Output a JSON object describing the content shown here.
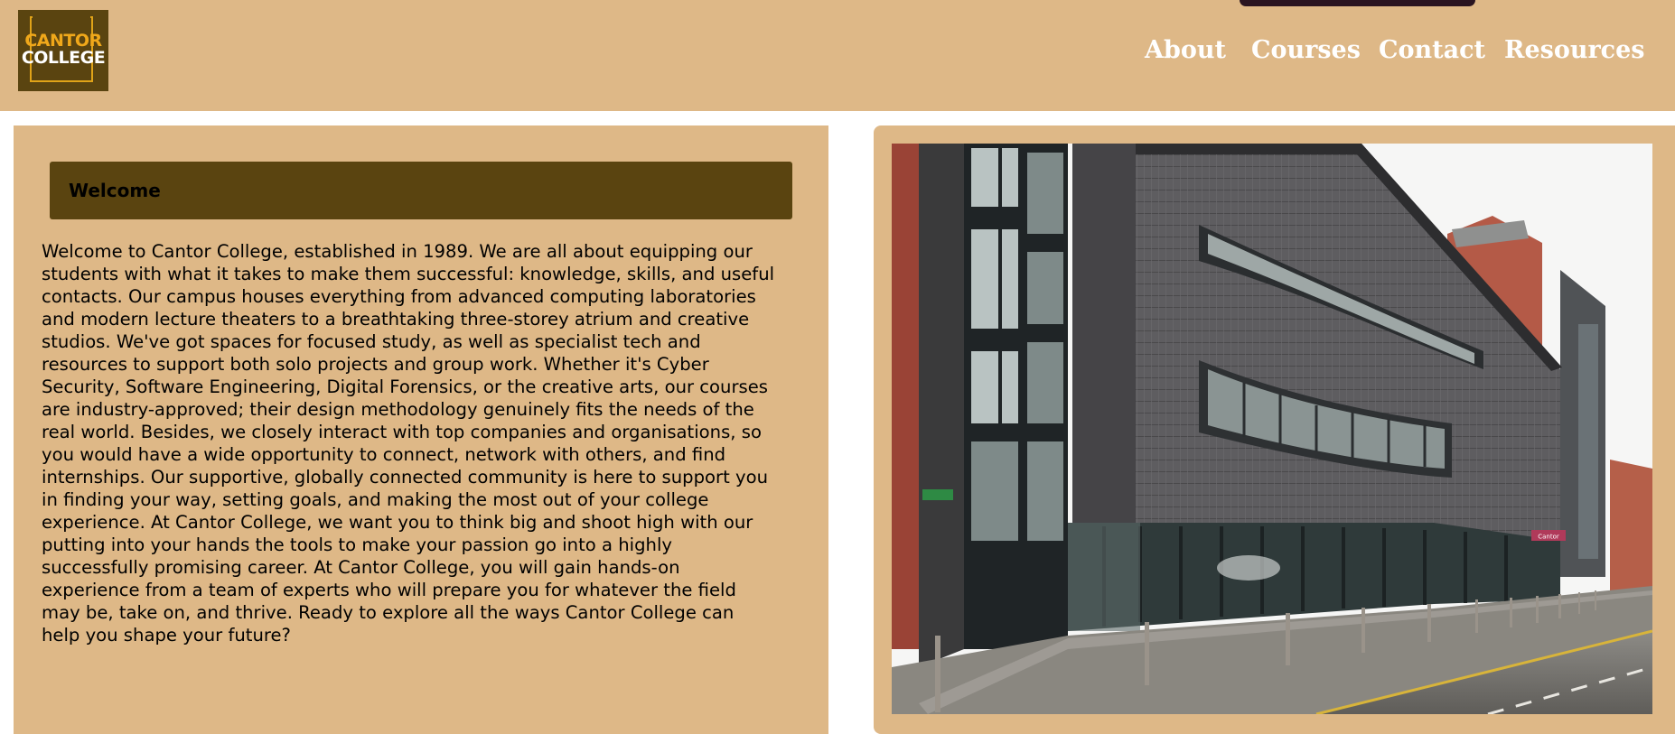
{
  "header": {
    "logo": {
      "line1": "CANTOR",
      "line2": "COLLEGE"
    },
    "nav": [
      {
        "label": "About"
      },
      {
        "label": "Courses"
      },
      {
        "label": "Contact"
      },
      {
        "label": "Resources"
      }
    ]
  },
  "main": {
    "welcome": {
      "title": "Welcome",
      "body": "Welcome to Cantor College, established in 1989. We are all about equipping our\nstudents with what it takes to make them successful: knowledge, skills, and useful\ncontacts. Our campus houses everything from advanced computing laboratories\nand modern lecture theaters to a breathtaking three-storey atrium and creative\nstudios. We've got spaces for focused study, as well as specialist tech and\nresources to support both solo projects and group work. Whether it's Cyber\nSecurity, Software Engineering, Digital Forensics, or the creative arts, our courses\nare industry-approved; their design methodology genuinely fits the needs of the\nreal world. Besides, we closely interact with top companies and organisations, so\nyou would have a wide opportunity to connect, network with others, and find\ninternships. Our supportive, globally connected community is here to support you\nin finding your way, setting goals, and making the most out of your college\nexperience. At Cantor College, we want you to think big and shoot high with our\nputting into your hands the tools to make your passion go into a highly\nsuccessfully promising career. At Cantor College, you will gain hands-on\nexperience from a team of experts who will prepare you for whatever the field\nmay be, take on, and thrive. Ready to explore all the ways Cantor College can\nhelp you shape your future?"
    },
    "photo": {
      "sign_text": "Cantor"
    }
  },
  "colors": {
    "header_bg": "#deb887",
    "panel_bg": "#deb887",
    "logo_bg": "#5a4410",
    "logo_accent": "#f0a81a",
    "welcome_bar_bg": "#5a4410",
    "nav_text": "#ffffff",
    "top_tab": "#2a1420"
  }
}
